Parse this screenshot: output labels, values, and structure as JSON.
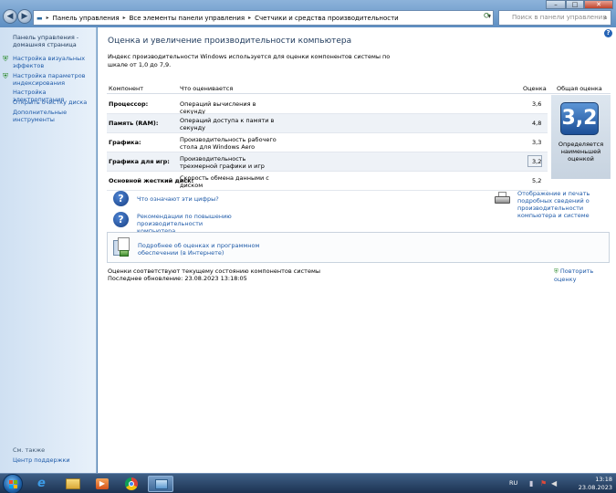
{
  "address_bar": {
    "crumbs": [
      "Панель управления",
      "Все элементы панели управления",
      "Счетчики и средства производительности"
    ],
    "search_placeholder": "Поиск в панели управления"
  },
  "sidebar": {
    "home": "Панель управления - домашняя страница",
    "items": [
      "Настройка визуальных эффектов",
      "Настройка параметров индексирования",
      "Настройка электропитания",
      "Открыть очистку диска",
      "Дополнительные инструменты"
    ],
    "see_also": "См. также",
    "see_also_item": "Центр поддержки"
  },
  "main": {
    "title": "Оценка и увеличение производительности компьютера",
    "intro": "Индекс производительности Windows используется для оценки компонентов системы по шкале от 1,0 до 7,9.",
    "columns": {
      "component": "Компонент",
      "rated": "Что оценивается",
      "score": "Оценка",
      "overall": "Общая оценка"
    },
    "rows": [
      {
        "component": "Процессор:",
        "desc": "Операций вычисления в секунду",
        "score": "3,6"
      },
      {
        "component": "Память (RAM):",
        "desc": "Операций доступа к памяти в секунду",
        "score": "4,8"
      },
      {
        "component": "Графика:",
        "desc": "Производительность рабочего стола для Windows Aero",
        "score": "3,3"
      },
      {
        "component": "Графика для игр:",
        "desc": "Производительность трехмерной графики и игр",
        "score": "3,2"
      },
      {
        "component": "Основной жесткий диск:",
        "desc": "Скорость обмена данными с диском",
        "score": "5,2"
      }
    ],
    "overall_score": "3,2",
    "overall_caption": "Определяется наименьшей оценкой",
    "links": {
      "what_numbers": "Что означают эти цифры?",
      "recommendations": "Рекомендации по повышению производительности компьютера.",
      "print": "Отображение и печать подробных сведений о производительности компьютера и системе",
      "details": "Подробнее об оценках и программном обеспечении (в Интернете)"
    },
    "status_line": "Оценки соответствуют текущему состоянию компонентов системы",
    "last_update": "Последнее обновление: 23.08.2023 13:18:05",
    "rerun": "Повторить оценку"
  },
  "taskbar": {
    "lang": "RU",
    "time": "13:18",
    "date": "23.08.2023"
  },
  "colors": {
    "link": "#1e5aa8",
    "badge": "#1c4f97",
    "title_text": "#1e395b"
  }
}
